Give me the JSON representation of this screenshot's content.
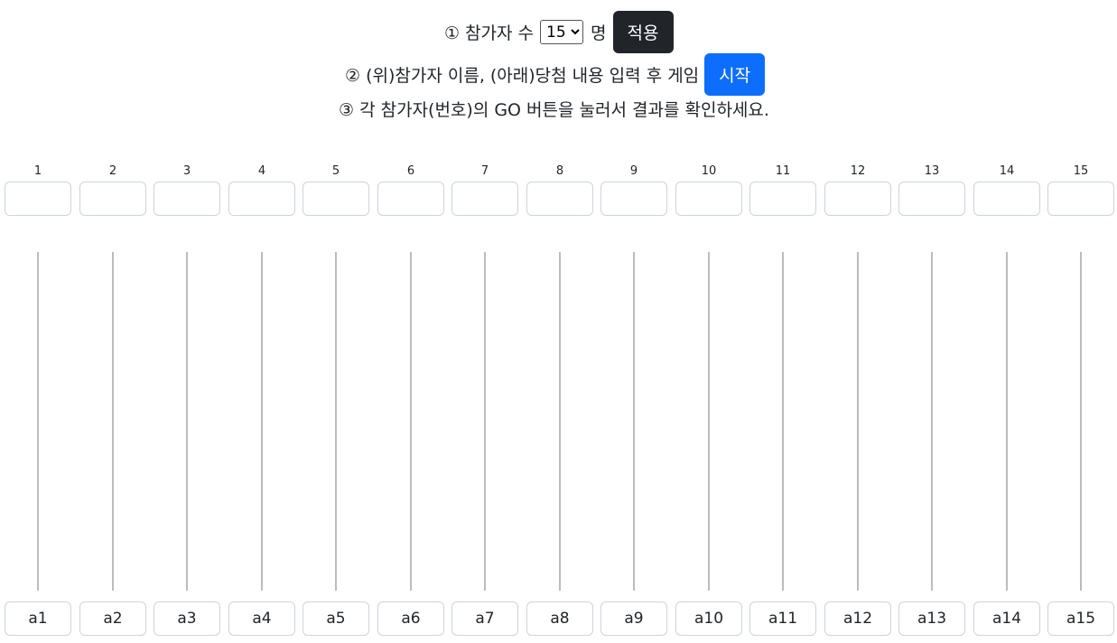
{
  "instructions": {
    "step1_prefix": "① 참가자 수",
    "participant_count": "15",
    "participant_options": [
      "15"
    ],
    "step1_suffix": "명",
    "apply_button": "적용",
    "step2_text": "② (위)참가자 이름, (아래)당첨 내용 입력 후 게임",
    "start_button": "시작",
    "step3_text": "③ 각 참가자(번호)의 GO 버튼을 눌러서 결과를 확인하세요."
  },
  "participants": [
    {
      "number": "1",
      "name": "",
      "prize": "a1"
    },
    {
      "number": "2",
      "name": "",
      "prize": "a2"
    },
    {
      "number": "3",
      "name": "",
      "prize": "a3"
    },
    {
      "number": "4",
      "name": "",
      "prize": "a4"
    },
    {
      "number": "5",
      "name": "",
      "prize": "a5"
    },
    {
      "number": "6",
      "name": "",
      "prize": "a6"
    },
    {
      "number": "7",
      "name": "",
      "prize": "a7"
    },
    {
      "number": "8",
      "name": "",
      "prize": "a8"
    },
    {
      "number": "9",
      "name": "",
      "prize": "a9"
    },
    {
      "number": "10",
      "name": "",
      "prize": "a10"
    },
    {
      "number": "11",
      "name": "",
      "prize": "a11"
    },
    {
      "number": "12",
      "name": "",
      "prize": "a12"
    },
    {
      "number": "13",
      "name": "",
      "prize": "a13"
    },
    {
      "number": "14",
      "name": "",
      "prize": "a14"
    },
    {
      "number": "15",
      "name": "",
      "prize": "a15"
    }
  ],
  "colors": {
    "apply_button_bg": "#212529",
    "start_button_bg": "#0d6efd",
    "ladder_line": "#bcbcbc"
  }
}
